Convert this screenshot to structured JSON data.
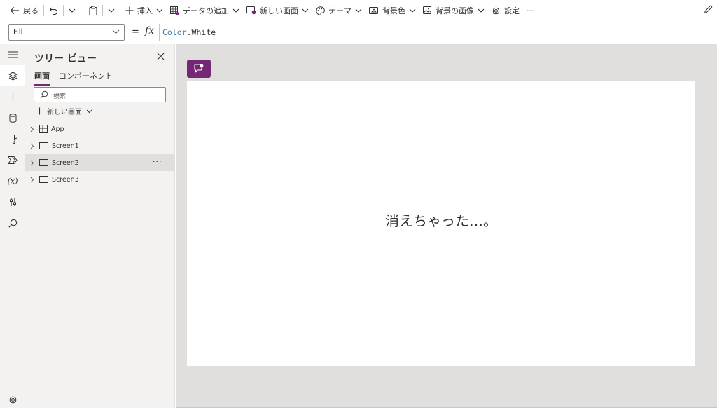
{
  "toolbar": {
    "back_label": "戻る",
    "insert_label": "挿入",
    "add_data_label": "データの追加",
    "new_screen_label": "新しい画面",
    "theme_label": "テーマ",
    "bg_color_label": "背景色",
    "bg_image_label": "背景の画像",
    "settings_label": "設定",
    "more_label": "···"
  },
  "formula_bar": {
    "property": "Fill",
    "equals": "=",
    "fx": "fx",
    "formula_obj": "Color",
    "formula_rest": ".White"
  },
  "rail": {
    "variables_label": "(x)"
  },
  "tree_view": {
    "title": "ツリー ビュー",
    "tabs": [
      {
        "label": "画面",
        "active": true
      },
      {
        "label": "コンポーネント",
        "active": false
      }
    ],
    "search_placeholder": "検索",
    "new_screen_label": "新しい画面",
    "nodes": [
      {
        "label": "App",
        "icon": "app-icon"
      },
      {
        "label": "Screen1",
        "icon": "screen-icon"
      },
      {
        "label": "Screen2",
        "icon": "screen-icon",
        "selected": true
      },
      {
        "label": "Screen3",
        "icon": "screen-icon"
      }
    ],
    "more_label": "···"
  },
  "canvas": {
    "screen_text": "消えちゃった…。"
  },
  "colors": {
    "accent": "#742774",
    "panel_bg": "#f3f2f1",
    "canvas_bg": "#e1dfdd",
    "selected_row": "#e1dfdd"
  }
}
